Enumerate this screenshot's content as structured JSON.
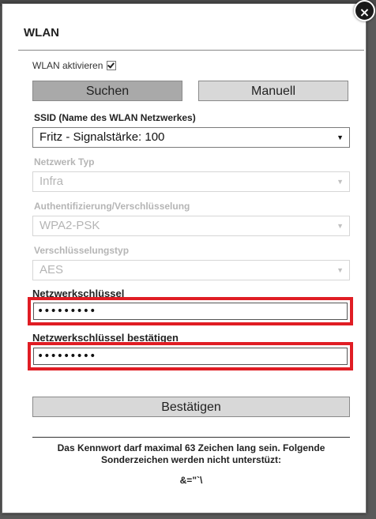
{
  "dialog": {
    "title": "WLAN",
    "close_label": "×",
    "wlan_enable_label": "WLAN aktivieren",
    "wlan_enabled": true,
    "buttons": {
      "search": "Suchen",
      "manual": "Manuell",
      "confirm": "Bestätigen"
    },
    "ssid": {
      "label": "SSID (Name des WLAN Netzwerkes)",
      "value": "Fritz - Signalstärke: 100"
    },
    "network_type": {
      "label": "Netzwerk Typ",
      "value": "Infra"
    },
    "auth": {
      "label": "Authentifizierung/Verschlüsselung",
      "value": "WPA2-PSK"
    },
    "encryption": {
      "label": "Verschlüsselungstyp",
      "value": "AES"
    },
    "network_key": {
      "label": "Netzwerkschlüssel",
      "value": "•••••••••"
    },
    "network_key_confirm": {
      "label": "Netzwerkschlüssel bestätigen",
      "value": "•••••••••"
    },
    "note": "Das Kennwort darf maximal 63 Zeichen lang sein. Folgende Sonderzeichen werden nicht unterstüzt:",
    "forbidden_chars": "&=\"`\\"
  },
  "colors": {
    "highlight": "#e01d24",
    "button_active": "#a9a9a9",
    "button": "#d8d8d8"
  }
}
